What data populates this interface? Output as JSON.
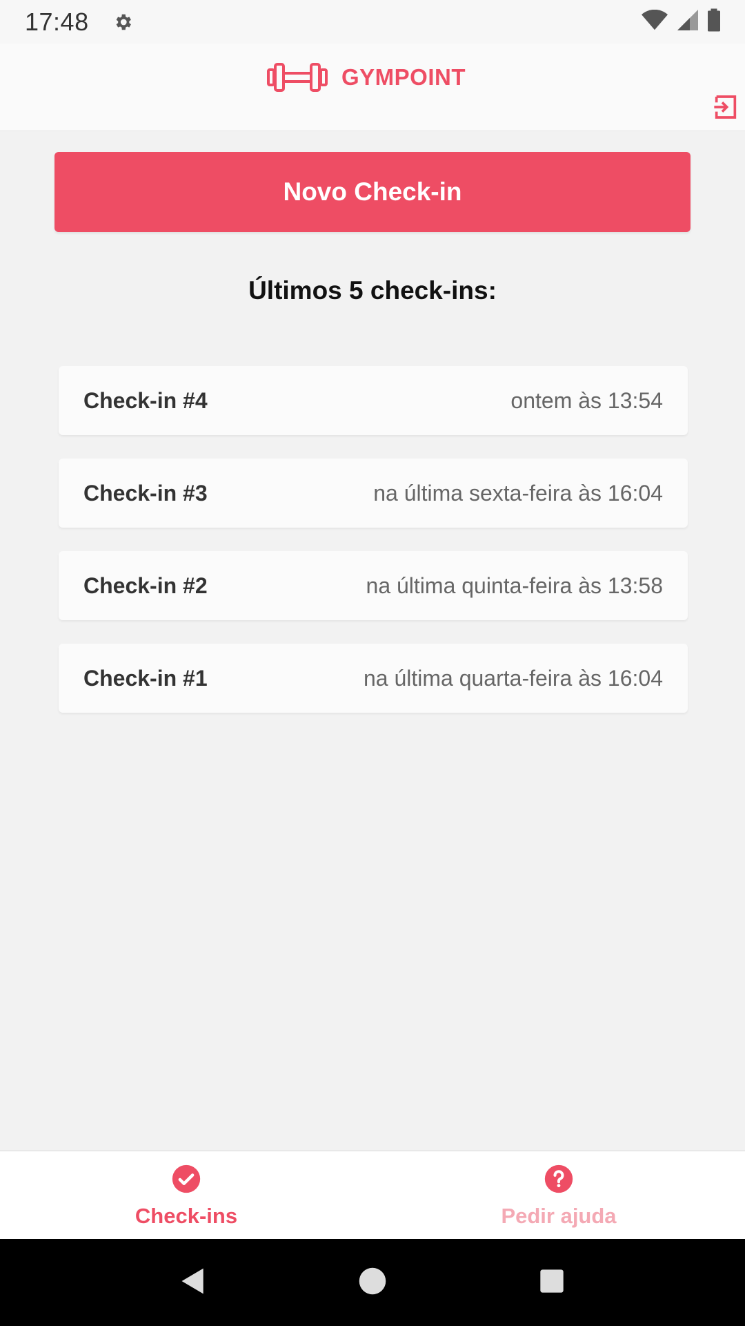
{
  "status_bar": {
    "time": "17:48",
    "icons": [
      "gear-icon",
      "wifi-icon",
      "signal-icon",
      "battery-icon"
    ]
  },
  "header": {
    "brand_name": "GYMPOINT",
    "logo_icon": "dumbbell-icon",
    "logout_icon": "logout-icon"
  },
  "main": {
    "new_checkin_label": "Novo Check-in",
    "section_title": "Últimos 5 check-ins:",
    "checkins": [
      {
        "title": "Check-in #4",
        "time": "ontem às 13:54"
      },
      {
        "title": "Check-in #3",
        "time": "na última sexta-feira às 16:04"
      },
      {
        "title": "Check-in #2",
        "time": "na última quinta-feira às 13:58"
      },
      {
        "title": "Check-in #1",
        "time": "na última quarta-feira às 16:04"
      }
    ]
  },
  "tabs": [
    {
      "label": "Check-ins",
      "icon": "check-circle-icon",
      "active": true
    },
    {
      "label": "Pedir ajuda",
      "icon": "help-circle-icon",
      "active": false
    }
  ],
  "nav_bar": {
    "buttons": [
      "back-icon",
      "home-icon",
      "recents-icon"
    ]
  },
  "colors": {
    "accent": "#ee4d64",
    "accent_light": "#f4a9b4",
    "background": "#f2f2f2"
  }
}
